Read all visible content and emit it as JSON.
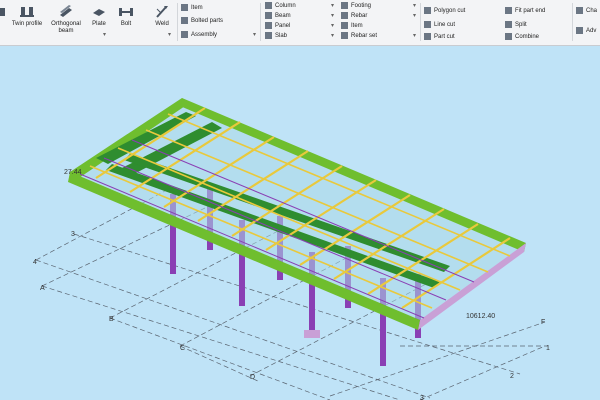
{
  "ribbon": {
    "large_buttons": {
      "twin_profile": "Twin profile",
      "orthogonal_beam": "Orthogonal beam",
      "plate": "Plate",
      "bolt": "Bolt",
      "weld": "Weld"
    },
    "links": {
      "item": "Item",
      "bolted_parts": "Bolted parts",
      "assembly": "Assembly",
      "column": "Column",
      "beam": "Beam",
      "panel": "Panel",
      "slab": "Slab",
      "footing": "Footing",
      "rebar": "Rebar",
      "item2": "Item",
      "rebar_set": "Rebar set",
      "polygon_cut": "Polygon cut",
      "line_cut": "Line cut",
      "part_cut": "Part cut",
      "fit_part_end": "Fit part end",
      "split": "Split",
      "combine": "Combine",
      "cha": "Cha",
      "adv": "Adv"
    },
    "colors": {
      "background": "#f3f4f6",
      "icon": "#4a5563"
    }
  },
  "viewport": {
    "background": "#bfe3f7",
    "grid_labels": [
      "A",
      "B",
      "C",
      "D",
      "3",
      "4",
      "F",
      "1",
      "2",
      "3"
    ],
    "dimension_labels": [
      "27.44",
      "10612.40"
    ],
    "colors": {
      "truss": "#6fbe2e",
      "beam": "#e9c93c",
      "deck": "#2f8d2f",
      "column": "#8a3fb4",
      "grid_line": "#5a6470"
    }
  }
}
